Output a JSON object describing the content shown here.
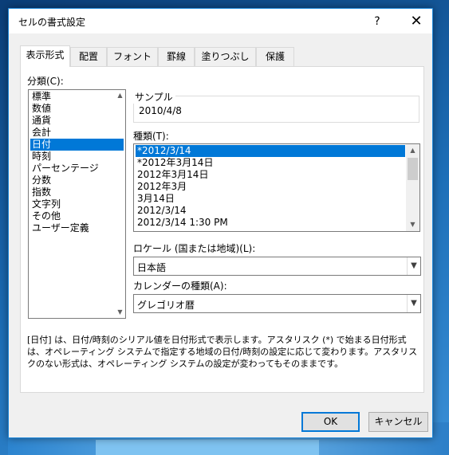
{
  "dialog": {
    "title": "セルの書式設定",
    "help_label": "?",
    "close_label": "✕"
  },
  "tabs": [
    {
      "label": "表示形式"
    },
    {
      "label": "配置"
    },
    {
      "label": "フォント"
    },
    {
      "label": "罫線"
    },
    {
      "label": "塗りつぶし"
    },
    {
      "label": "保護"
    }
  ],
  "category": {
    "label": "分類(C):",
    "items": [
      "標準",
      "数値",
      "通貨",
      "会計",
      "日付",
      "時刻",
      "パーセンテージ",
      "分数",
      "指数",
      "文字列",
      "その他",
      "ユーザー定義"
    ],
    "selected": "日付"
  },
  "sample": {
    "label": "サンプル",
    "value": "2010/4/8"
  },
  "type": {
    "label": "種類(T):",
    "items": [
      "*2012/3/14",
      "*2012年3月14日",
      "2012年3月14日",
      "2012年3月",
      "3月14日",
      "2012/3/14",
      "2012/3/14 1:30 PM"
    ],
    "selected": "*2012/3/14"
  },
  "locale": {
    "label": "ロケール (国または地域)(L):",
    "value": "日本語"
  },
  "calendar": {
    "label": "カレンダーの種類(A):",
    "value": "グレゴリオ暦"
  },
  "description": "[日付] は、日付/時刻のシリアル値を日付形式で表示します。アスタリスク (*) で始まる日付形式は、オペレーティング システムで指定する地域の日付/時刻の設定に応じて変わります。アスタリスクのない形式は、オペレーティング システムの設定が変わってもそのままです。",
  "buttons": {
    "ok": "OK",
    "cancel": "キャンセル"
  },
  "icons": {
    "scroll_up": "scroll-up-icon",
    "scroll_down": "scroll-down-icon",
    "dropdown": "chevron-down-icon"
  },
  "colors": {
    "selection": "#0078d7",
    "dialog_border": "#1883d7"
  }
}
